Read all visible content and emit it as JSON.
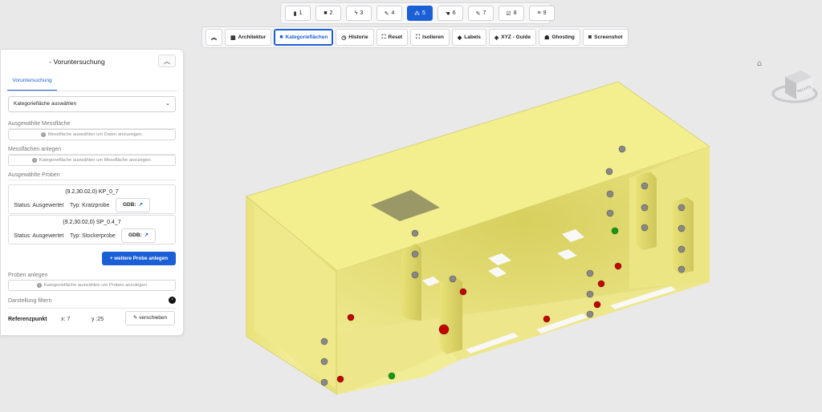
{
  "steps": [
    {
      "icon": "bookmark-icon",
      "glyph": "▮",
      "label": "1",
      "active": false
    },
    {
      "icon": "square-icon",
      "glyph": "■",
      "label": "2",
      "active": false
    },
    {
      "icon": "bolt-icon",
      "glyph": "ϟ",
      "label": "3",
      "active": false
    },
    {
      "icon": "pen-icon",
      "glyph": "✎",
      "label": "4",
      "active": false
    },
    {
      "icon": "network-icon",
      "glyph": "⁂",
      "label": "5",
      "active": true
    },
    {
      "icon": "hand-icon",
      "glyph": "☚",
      "label": "6",
      "active": false
    },
    {
      "icon": "pen-icon",
      "glyph": "✎",
      "label": "7",
      "active": false
    },
    {
      "icon": "checkbox-icon",
      "glyph": "☑",
      "label": "8",
      "active": false
    },
    {
      "icon": "database-icon",
      "glyph": "≡",
      "label": "9",
      "active": false
    }
  ],
  "toolbar": {
    "collapse": {
      "icon": "double-chevron-up-icon",
      "glyph": "︽"
    },
    "architektur": {
      "icon": "building-icon",
      "glyph": "▦",
      "label": "Architektur"
    },
    "kategorieflaechen": {
      "icon": "square-icon",
      "glyph": "■",
      "label": "Kategorieflächen"
    },
    "historie": {
      "icon": "clock-icon",
      "glyph": "◷",
      "label": "Historie"
    },
    "reset": {
      "icon": "expand-icon",
      "glyph": "⛶",
      "label": "Reset"
    },
    "isolieren": {
      "icon": "isolate-icon",
      "glyph": "⛶",
      "label": "Isolieren"
    },
    "labels": {
      "icon": "tags-icon",
      "glyph": "◆",
      "label": "Labels"
    },
    "xyz": {
      "icon": "cube-icon",
      "glyph": "◈",
      "label": "XYZ - Guide"
    },
    "ghosting": {
      "icon": "ghost-icon",
      "glyph": "☗",
      "label": "Ghosting"
    },
    "screenshot": {
      "icon": "camera-icon",
      "glyph": "◙",
      "label": "Screenshot"
    }
  },
  "panel": {
    "title": "- Voruntersuchung",
    "tab": "Voruntersuchung",
    "select": "Kategoriefläche auswählen",
    "sec_messflaeche": "Ausgewählte Messfläche",
    "info_messflaeche": "Messfläche auswählen um Daten anzuzeigen.",
    "sec_anlegen": "Messflächen anlegen",
    "info_anlegen": "Kategoriefläche auswählen um Messfläche anzulegen.",
    "sec_proben": "Ausgewählte Proben",
    "proben": [
      {
        "title": "(9.2,30.02,0) KP_0_7",
        "status": "Status: Ausgewertet",
        "typ": "Typ: Kratzprobe",
        "gdb": "GDB:"
      },
      {
        "title": "(9.2,30.02,0) SP_0.4_7",
        "status": "Status: Ausgewertet",
        "typ": "Typ: Stockerprobe",
        "gdb": "GDB:"
      }
    ],
    "add_probe": "+ weitere Probe anlegen",
    "sec_proben_anlegen": "Proben anlegen",
    "info_proben_anlegen": "Kategoriefläche auswählen um Proben anzulegen",
    "filter": "Darstellung filtern",
    "ref_label": "Referenzpunkt",
    "ref_x": "x: 7",
    "ref_y": "y :25",
    "verschieben": "verschieben"
  },
  "viewcube_label": "RECHTS",
  "colors": {
    "accent": "#1b5fd6",
    "surface": "#f3ef8f",
    "red_marker": "#c40000",
    "green_marker": "#129a12",
    "gray_marker": "#888888"
  }
}
